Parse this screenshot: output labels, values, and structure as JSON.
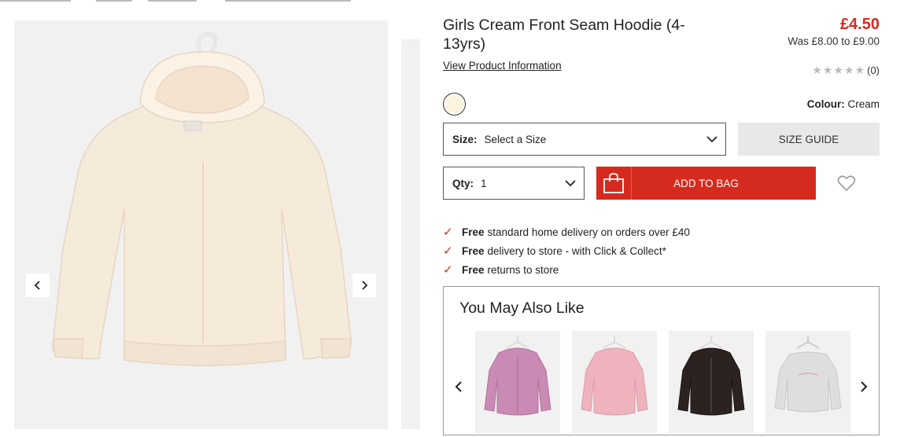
{
  "product": {
    "title": "Girls Cream Front Seam Hoodie (4-13yrs)",
    "price": "£4.50",
    "was_price": "Was £8.00 to £9.00",
    "view_info": "View Product Information",
    "rating_count": "(0)",
    "stars": "★★★★★",
    "colour_label": "Colour:",
    "colour_value": "Cream",
    "swatch_color": "#fbf3dd"
  },
  "size_select": {
    "label": "Size:",
    "value": "Select a Size"
  },
  "size_guide": "SIZE GUIDE",
  "qty_select": {
    "label": "Qty:",
    "value": "1"
  },
  "add_to_bag": "ADD TO BAG",
  "benefits": [
    {
      "strong": "Free",
      "text": "standard home delivery on orders over £40"
    },
    {
      "strong": "Free",
      "text": "delivery to store - with Click & Collect*"
    },
    {
      "strong": "Free",
      "text": "returns to store"
    }
  ],
  "also_like": {
    "heading": "You May Also Like",
    "items": [
      {
        "color": "#c98bb4",
        "icon": "pink-hoodie-image"
      },
      {
        "color": "#efb3bd",
        "icon": "light-pink-hoodie-image"
      },
      {
        "color": "#2c2320",
        "icon": "black-hoodie-image"
      },
      {
        "color": "#dedede",
        "icon": "grey-sweatshirt-image"
      }
    ]
  },
  "colors": {
    "accent": "#d52b1e",
    "hoodie": "#f4e8d6"
  }
}
